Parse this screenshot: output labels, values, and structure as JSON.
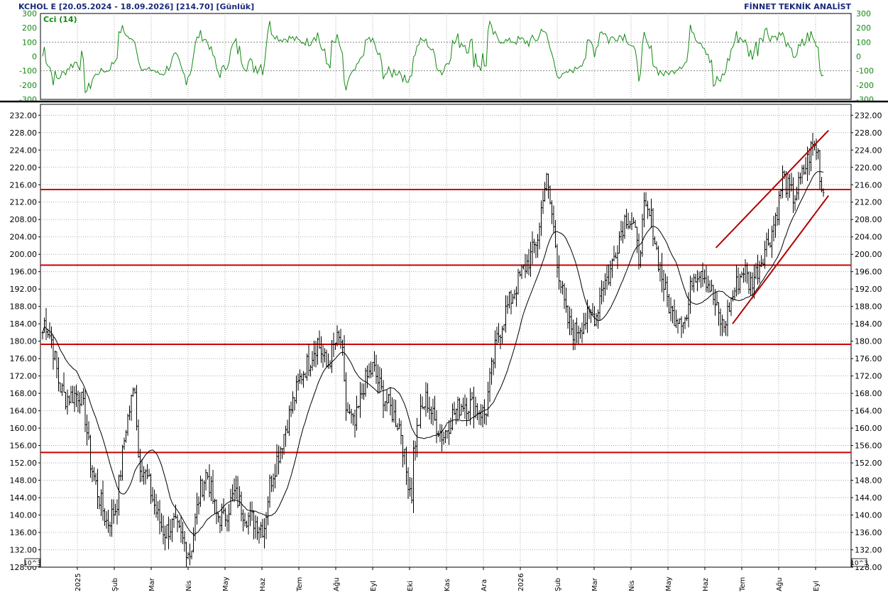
{
  "header": {
    "left_title": "KCHOL E  [20.05.2024 - 18.09.2026]  [214.70]  [Günlük]",
    "right_title": "FİNNET TEKNİK ANALİST"
  },
  "cci_panel": {
    "label": "Cci (14)",
    "ticks": [
      "300",
      "200",
      "100",
      "0",
      "-100",
      "-200",
      "-300"
    ],
    "tick_values": [
      300,
      200,
      100,
      0,
      -100,
      -200,
      -300
    ],
    "range": [
      -300,
      300
    ],
    "reference_lines": [
      100,
      -100
    ],
    "line_color": "#138a13"
  },
  "price_panel": {
    "ticks": [
      "232.00",
      "228.00",
      "224.00",
      "220.00",
      "216.00",
      "212.00",
      "208.00",
      "204.00",
      "200.00",
      "196.00",
      "192.00",
      "188.00",
      "184.00",
      "180.00",
      "176.00",
      "172.00",
      "168.00",
      "164.00",
      "160.00",
      "156.00",
      "152.00",
      "148.00",
      "144.00",
      "140.00",
      "136.00",
      "132.00",
      "128.00"
    ],
    "tick_values": [
      232,
      228,
      224,
      220,
      216,
      212,
      208,
      204,
      200,
      196,
      192,
      188,
      184,
      180,
      176,
      172,
      168,
      164,
      160,
      156,
      152,
      148,
      144,
      140,
      136,
      132,
      128
    ],
    "range": [
      128,
      234.5
    ],
    "multiplier_label": "10^3",
    "multiplier_label_right": "10^3"
  },
  "x_axis": {
    "labels": [
      "2025",
      "Şub",
      "Mar",
      "Nis",
      "May",
      "Haz",
      "Tem",
      "Ağu",
      "Eyl",
      "Eki",
      "Kas",
      "Ara",
      "2026",
      "Şub",
      "Mar",
      "Nis",
      "May",
      "Haz",
      "Tem",
      "Ağu",
      "Eyl"
    ]
  },
  "colors": {
    "bars": "#000000",
    "moving_average": "#000000",
    "support_resistance": "#cc0000",
    "channel": "#b00000",
    "grid": "#9a9a9a",
    "header_text": "#1a2a7a"
  },
  "chart_data": {
    "type": "ohlc",
    "title": "KCHOL E  [20.05.2024 - 18.09.2026]  [214.70]  [Günlük]",
    "months": [
      "2025",
      "Şub",
      "Mar",
      "Nis",
      "May",
      "Haz",
      "Tem",
      "Ağu",
      "Eyl",
      "Eki",
      "Kas",
      "Ara",
      "2026",
      "Şub",
      "Mar",
      "Nis",
      "May",
      "Haz",
      "Tem",
      "Ağu",
      "Eyl"
    ],
    "price_path": [
      [
        0,
        182
      ],
      [
        0.06,
        185
      ],
      [
        0.25,
        180
      ],
      [
        0.45,
        170
      ],
      [
        0.6,
        167
      ],
      [
        1.0,
        168
      ],
      [
        1.15,
        163
      ],
      [
        1.3,
        152
      ],
      [
        1.5,
        145
      ],
      [
        1.75,
        138
      ],
      [
        2.0,
        142
      ],
      [
        2.25,
        160
      ],
      [
        2.5,
        170
      ],
      [
        2.6,
        153
      ],
      [
        2.85,
        148
      ],
      [
        3.1,
        140
      ],
      [
        3.3,
        136
      ],
      [
        3.55,
        138
      ],
      [
        3.8,
        134
      ],
      [
        4.0,
        131
      ],
      [
        4.25,
        145
      ],
      [
        4.45,
        150
      ],
      [
        4.7,
        140
      ],
      [
        4.9,
        139
      ],
      [
        5.2,
        145
      ],
      [
        5.5,
        140
      ],
      [
        5.85,
        138
      ],
      [
        6.0,
        137
      ],
      [
        6.15,
        147
      ],
      [
        6.45,
        156
      ],
      [
        6.75,
        165
      ],
      [
        7.0,
        172
      ],
      [
        7.25,
        176
      ],
      [
        7.45,
        180
      ],
      [
        7.7,
        174
      ],
      [
        7.95,
        180
      ],
      [
        8.1,
        180
      ],
      [
        8.2,
        165
      ],
      [
        8.45,
        160
      ],
      [
        8.7,
        170
      ],
      [
        8.95,
        174
      ],
      [
        9.2,
        168
      ],
      [
        9.45,
        164
      ],
      [
        9.7,
        160
      ],
      [
        9.85,
        150
      ],
      [
        10.0,
        145
      ],
      [
        10.05,
        155
      ],
      [
        10.2,
        162
      ],
      [
        10.4,
        167
      ],
      [
        10.6,
        162
      ],
      [
        10.85,
        158
      ],
      [
        11.1,
        163
      ],
      [
        11.4,
        166
      ],
      [
        11.7,
        165
      ],
      [
        12.0,
        163
      ],
      [
        12.1,
        170
      ],
      [
        12.3,
        180
      ],
      [
        12.55,
        187
      ],
      [
        12.8,
        192
      ],
      [
        13.0,
        196
      ],
      [
        13.25,
        200
      ],
      [
        13.45,
        205
      ],
      [
        13.55,
        214
      ],
      [
        13.65,
        217
      ],
      [
        13.8,
        209
      ],
      [
        14.0,
        195
      ],
      [
        14.2,
        185
      ],
      [
        14.4,
        182
      ],
      [
        14.6,
        184
      ],
      [
        14.85,
        186
      ],
      [
        15.0,
        186
      ],
      [
        15.15,
        193
      ],
      [
        15.35,
        195
      ],
      [
        15.55,
        202
      ],
      [
        15.8,
        209
      ],
      [
        16.0,
        207
      ],
      [
        16.15,
        199
      ],
      [
        16.3,
        210
      ],
      [
        16.5,
        208
      ],
      [
        16.65,
        200
      ],
      [
        16.85,
        192
      ],
      [
        17.05,
        186
      ],
      [
        17.25,
        186
      ],
      [
        17.45,
        185
      ],
      [
        17.6,
        195
      ],
      [
        17.85,
        197
      ],
      [
        18.1,
        192
      ],
      [
        18.3,
        186
      ],
      [
        18.45,
        183
      ],
      [
        18.6,
        188
      ],
      [
        18.8,
        193
      ],
      [
        19.0,
        197
      ],
      [
        19.15,
        193
      ],
      [
        19.35,
        196
      ],
      [
        19.55,
        201
      ],
      [
        19.75,
        205
      ],
      [
        19.95,
        212
      ],
      [
        20.05,
        218
      ],
      [
        20.2,
        215
      ],
      [
        20.35,
        213
      ],
      [
        20.5,
        216
      ],
      [
        20.7,
        221
      ],
      [
        20.85,
        225
      ],
      [
        21.0,
        224
      ],
      [
        21.1,
        215
      ],
      [
        21.18,
        214.7
      ]
    ],
    "moving_average_period": 20,
    "horizontal_levels": [
      214.9,
      197.5,
      179.3,
      154.4
    ],
    "channel_upper": [
      [
        18.3,
        201.5
      ],
      [
        21.35,
        228.5
      ]
    ],
    "channel_lower": [
      [
        18.75,
        184
      ],
      [
        21.35,
        213.5
      ]
    ],
    "cci_period": 14,
    "xlabel": "",
    "ylabel": "",
    "ylim": [
      128,
      234.5
    ]
  }
}
